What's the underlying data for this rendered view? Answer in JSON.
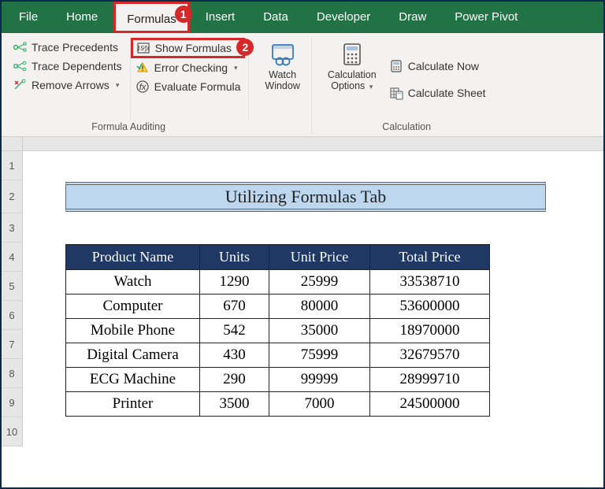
{
  "menubar": {
    "tabs": [
      "File",
      "Home",
      "Formulas",
      "Insert",
      "Data",
      "Developer",
      "Draw",
      "Power Pivot"
    ],
    "active_index": 2,
    "callout_1": "1"
  },
  "ribbon": {
    "auditing": {
      "trace_precedents": "Trace Precedents",
      "trace_dependents": "Trace Dependents",
      "remove_arrows": "Remove Arrows",
      "show_formulas": "Show Formulas",
      "error_checking": "Error Checking",
      "evaluate_formula": "Evaluate Formula",
      "group_label": "Formula Auditing",
      "callout_2": "2"
    },
    "watch": {
      "line1": "Watch",
      "line2": "Window"
    },
    "calc": {
      "options_line1": "Calculation",
      "options_line2": "Options",
      "calculate_now": "Calculate Now",
      "calculate_sheet": "Calculate Sheet",
      "group_label": "Calculation"
    }
  },
  "title": "Utilizing Formulas Tab",
  "headers": [
    "Product Name",
    "Units",
    "Unit Price",
    "Total Price"
  ],
  "rows": [
    {
      "name": "Watch",
      "units": "1290",
      "price": "25999",
      "total": "33538710"
    },
    {
      "name": "Computer",
      "units": "670",
      "price": "80000",
      "total": "53600000"
    },
    {
      "name": "Mobile Phone",
      "units": "542",
      "price": "35000",
      "total": "18970000"
    },
    {
      "name": "Digital Camera",
      "units": "430",
      "price": "75999",
      "total": "32679570"
    },
    {
      "name": "ECG Machine",
      "units": "290",
      "price": "99999",
      "total": "28999710"
    },
    {
      "name": "Printer",
      "units": "3500",
      "price": "7000",
      "total": "24500000"
    }
  ],
  "rownums": [
    "1",
    "2",
    "3",
    "4",
    "5",
    "6",
    "7",
    "8",
    "9",
    "10"
  ]
}
